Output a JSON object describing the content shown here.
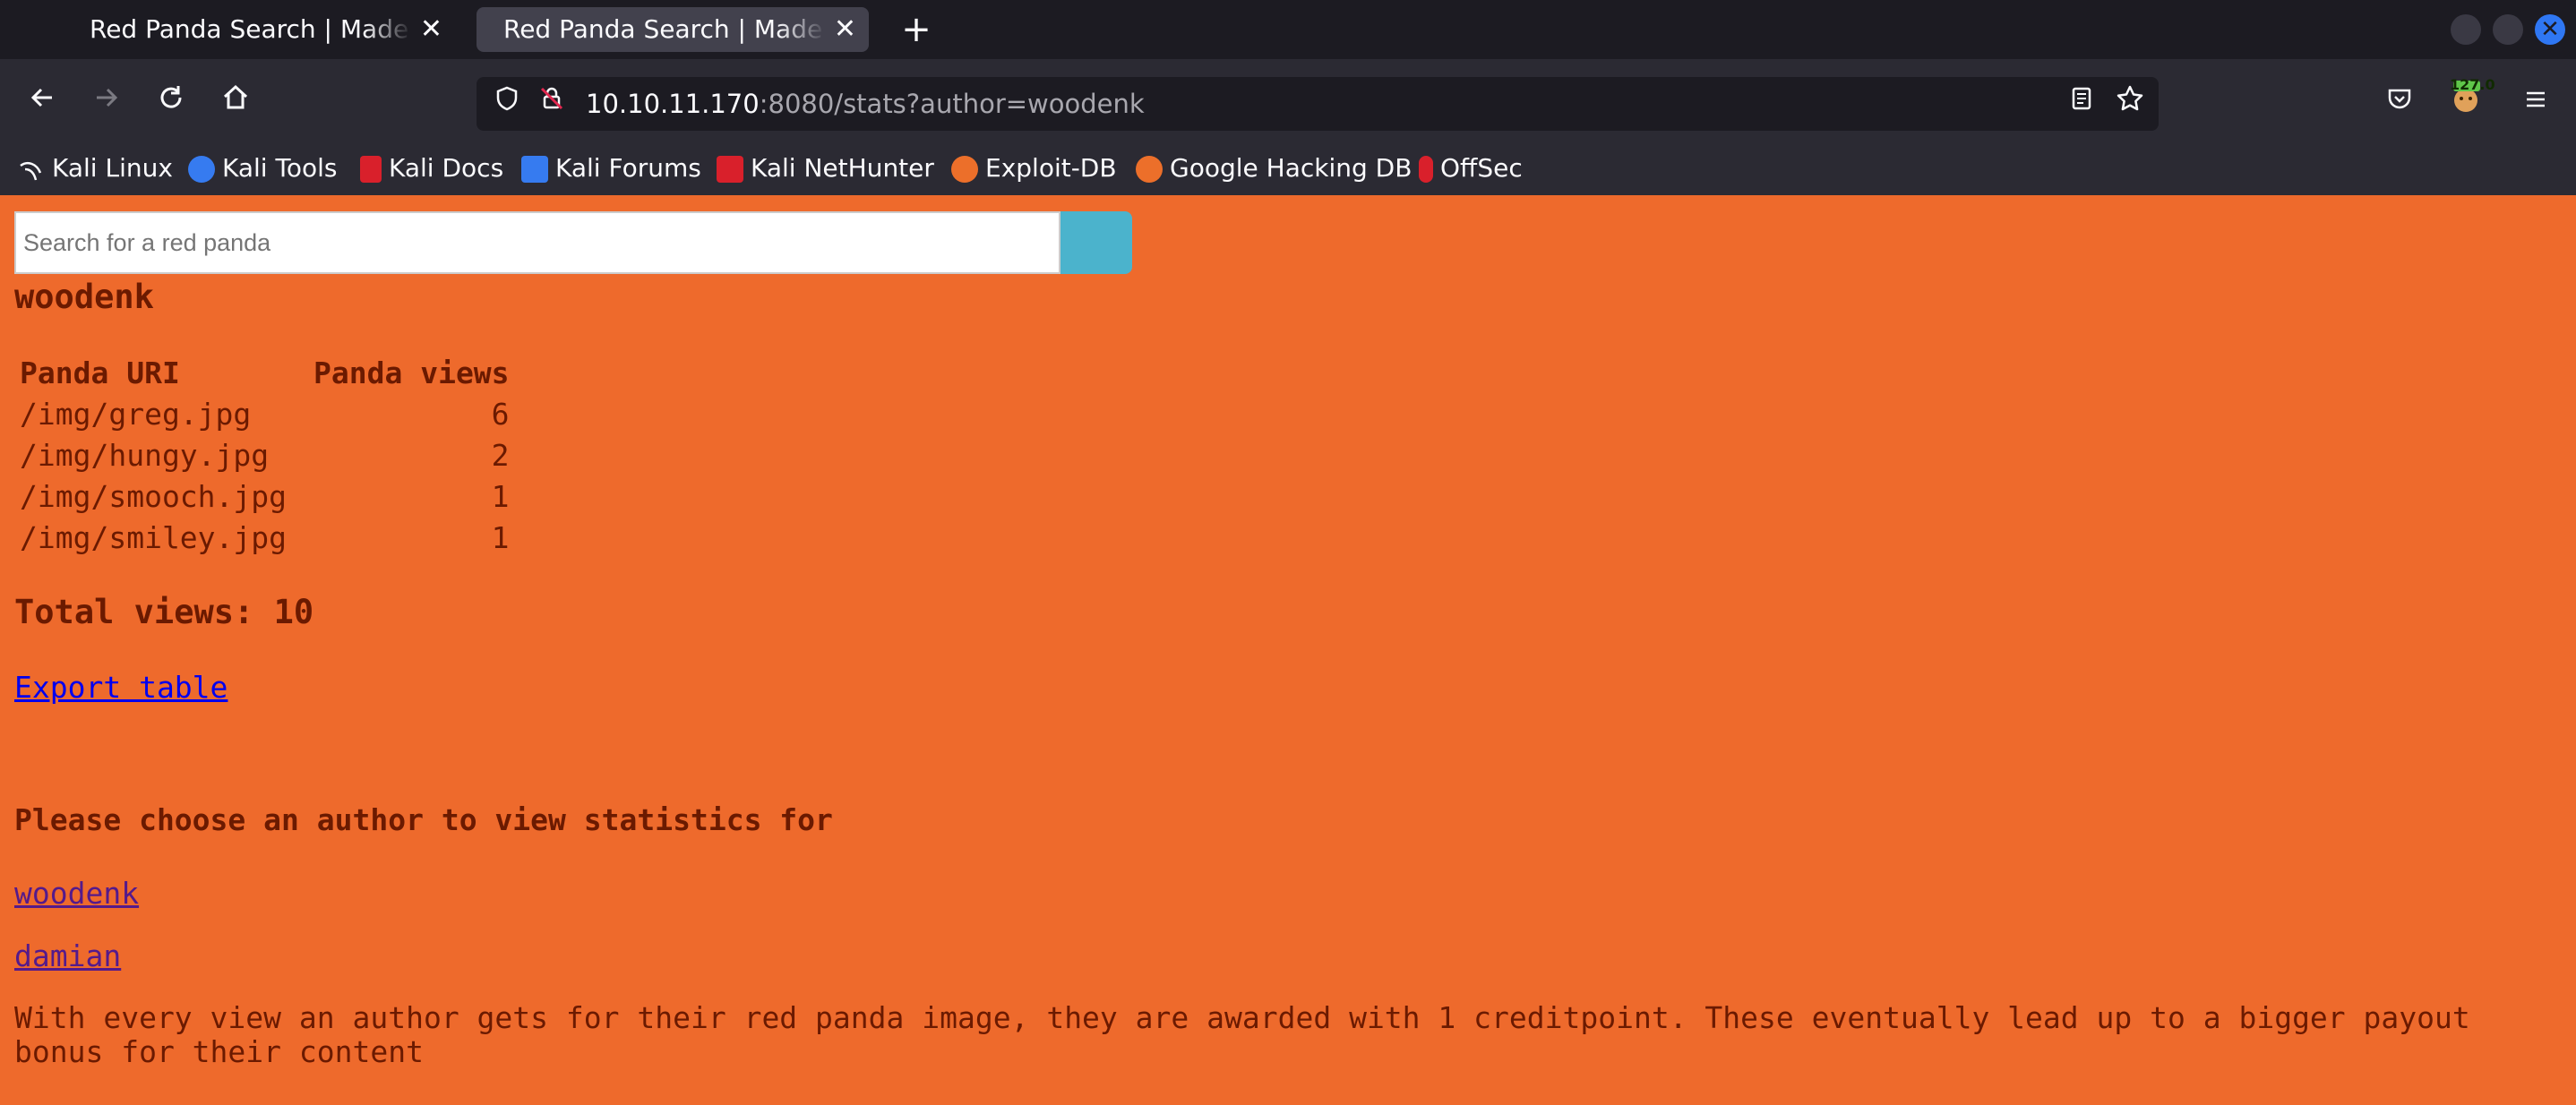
{
  "browser": {
    "tabs": [
      {
        "title": "Red Panda Search | Made with Spring Boot",
        "active": false
      },
      {
        "title": "Red Panda Search | Made with Spring Boot",
        "active": true
      }
    ],
    "url_host": "10.10.11.170",
    "url_rest": ":8080/stats?author=woodenk",
    "extension_badge": "127.0",
    "bookmarks": [
      {
        "label": "Kali Linux",
        "icon": "kali-dragon-icon"
      },
      {
        "label": "Kali Tools",
        "icon": "kali-tools-icon"
      },
      {
        "label": "Kali Docs",
        "icon": "kali-docs-icon"
      },
      {
        "label": "Kali Forums",
        "icon": "kali-forums-icon"
      },
      {
        "label": "Kali NetHunter",
        "icon": "kali-nethunter-icon"
      },
      {
        "label": "Exploit-DB",
        "icon": "exploit-db-icon"
      },
      {
        "label": "Google Hacking DB",
        "icon": "ghdb-icon"
      },
      {
        "label": "OffSec",
        "icon": "offsec-icon"
      }
    ]
  },
  "page": {
    "search_placeholder": "Search for a red panda",
    "author": "woodenk",
    "table": {
      "headers": [
        "Panda URI",
        "Panda views"
      ],
      "rows": [
        {
          "uri": "/img/greg.jpg",
          "views": "6"
        },
        {
          "uri": "/img/hungy.jpg",
          "views": "2"
        },
        {
          "uri": "/img/smooch.jpg",
          "views": "1"
        },
        {
          "uri": "/img/smiley.jpg",
          "views": "1"
        }
      ]
    },
    "total_views": "Total views: 10",
    "export_link": "Export table",
    "choose_heading": "Please choose an author to view statistics for",
    "authors": [
      "woodenk",
      "damian"
    ],
    "info_text": "With every view an author gets for their red panda image, they are awarded with 1 creditpoint. These eventually lead up to a bigger payout bonus for their content"
  },
  "colors": {
    "page_background": "#ee6a2c",
    "text": "#6b1a00",
    "search_button": "#4bb3cc",
    "chrome_dark": "#1c1b22",
    "chrome": "#2b2a33"
  }
}
